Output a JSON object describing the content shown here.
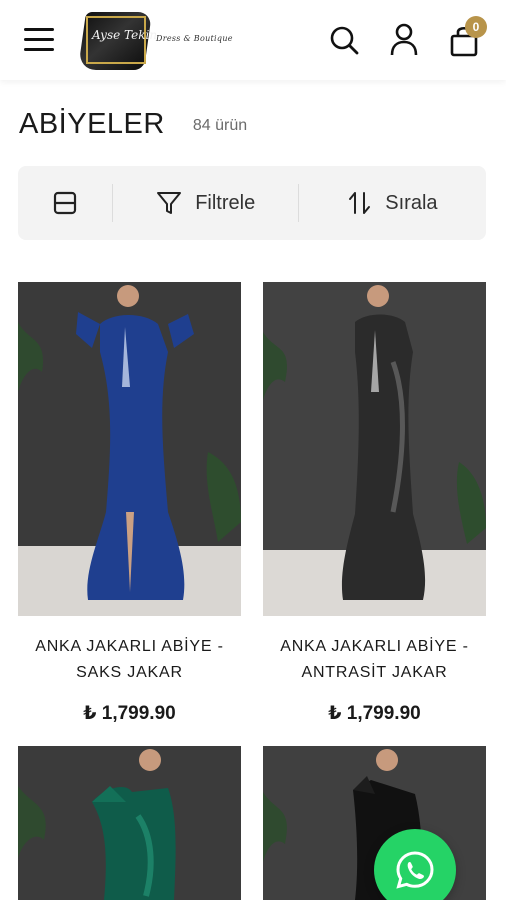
{
  "header": {
    "logo_text": "Ayse Tekin",
    "logo_tagline": "Dress & Boutique",
    "cart_count": "0",
    "accent_color": "#b8944a"
  },
  "category": {
    "title": "ABİYELER",
    "count": "84 ürün"
  },
  "toolbar": {
    "filter_label": "Filtrele",
    "sort_label": "Sırala"
  },
  "products": [
    {
      "name_line1": "ANKA JAKARLI ABİYE -",
      "name_line2": "SAKS JAKAR",
      "price": "₺ 1,799.90",
      "dress_color": "#1f3f8f"
    },
    {
      "name_line1": "ANKA JAKARLI ABİYE -",
      "name_line2": "ANTRASİT JAKAR",
      "price": "₺ 1,799.90",
      "dress_color": "#2b2b2b"
    },
    {
      "dress_color": "#0f5c4a"
    },
    {
      "dress_color": "#111111"
    }
  ],
  "icons": [
    "menu-icon",
    "search-icon",
    "user-icon",
    "cart-icon",
    "layout-grid-icon",
    "filter-icon",
    "sort-icon",
    "whatsapp-icon"
  ]
}
